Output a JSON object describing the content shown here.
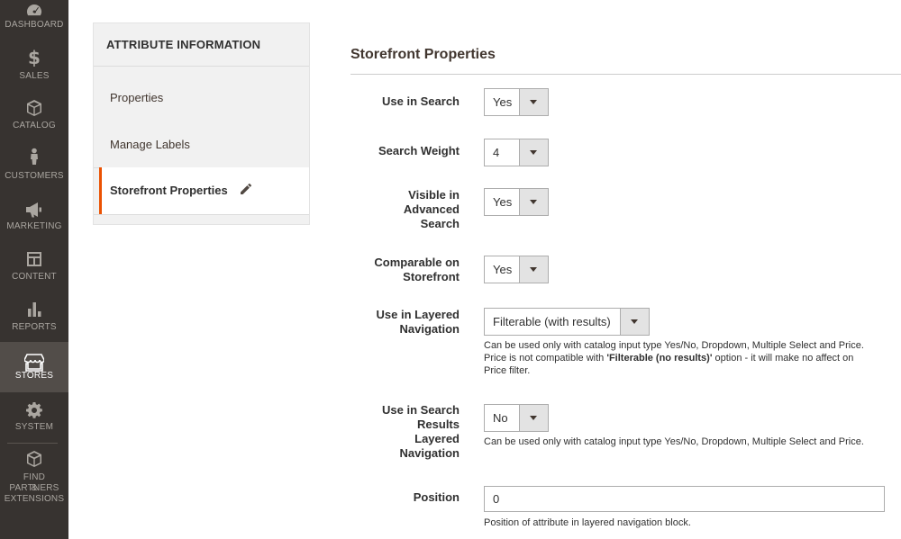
{
  "nav": {
    "items": [
      {
        "label": "DASHBOARD",
        "icon": "dashboard-icon"
      },
      {
        "label": "SALES",
        "icon": "dollar-icon"
      },
      {
        "label": "CATALOG",
        "icon": "box-icon"
      },
      {
        "label": "CUSTOMERS",
        "icon": "person-icon"
      },
      {
        "label": "MARKETING",
        "icon": "megaphone-icon"
      },
      {
        "label": "CONTENT",
        "icon": "layout-icon"
      },
      {
        "label": "REPORTS",
        "icon": "bar-chart-icon"
      },
      {
        "label": "STORES",
        "icon": "storefront-icon"
      },
      {
        "label": "SYSTEM",
        "icon": "gear-icon"
      },
      {
        "label_line1": "FIND PARTNERS",
        "label_line2": "& EXTENSIONS",
        "icon": "cubes-icon"
      }
    ],
    "active": "STORES"
  },
  "tabs": {
    "title": "ATTRIBUTE INFORMATION",
    "items": [
      {
        "label": "Properties"
      },
      {
        "label": "Manage Labels"
      },
      {
        "label": "Storefront Properties"
      }
    ],
    "active": "Storefront Properties"
  },
  "section": {
    "title": "Storefront Properties",
    "fields": {
      "use_in_search": {
        "label": "Use in Search",
        "value": "Yes"
      },
      "search_weight": {
        "label": "Search Weight",
        "value": "4"
      },
      "visible_advanced": {
        "label_line1": "Visible in",
        "label_line2": "Advanced",
        "label_line3": "Search",
        "value": "Yes"
      },
      "comparable": {
        "label_line1": "Comparable on",
        "label_line2": "Storefront",
        "value": "Yes"
      },
      "layered_nav": {
        "label_line1": "Use in Layered",
        "label_line2": "Navigation",
        "value": "Filterable (with results)",
        "note_line1": "Can be used only with catalog input type Yes/No, Dropdown, Multiple Select and Price.",
        "note_line2_pre": "Price is not compatible with ",
        "note_line2_bold": "'Filterable (no results)'",
        "note_line2_post": " option - it will make no affect on",
        "note_line3": "Price filter."
      },
      "search_results_layered": {
        "label_line1": "Use in Search",
        "label_line2": "Results",
        "label_line3": "Layered",
        "label_line4": "Navigation",
        "value": "No",
        "note": "Can be used only with catalog input type Yes/No, Dropdown, Multiple Select and Price."
      },
      "position": {
        "label": "Position",
        "value": "0",
        "note": "Position of attribute in layered navigation block."
      }
    }
  },
  "colors": {
    "nav_bg": "#373330",
    "nav_active": "#524d49",
    "accent": "#eb5202"
  }
}
